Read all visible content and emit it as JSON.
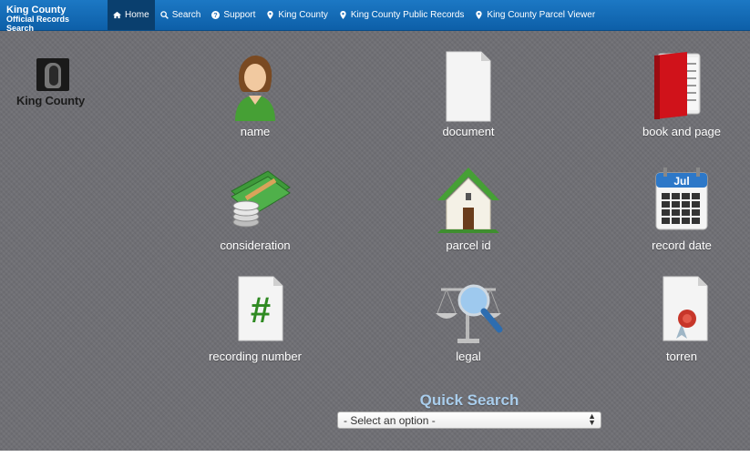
{
  "brand": {
    "line1": "King County",
    "line2": "Official Records Search"
  },
  "nav": [
    {
      "label": "Home",
      "icon": "home-icon",
      "active": true
    },
    {
      "label": "Search",
      "icon": "search-icon"
    },
    {
      "label": "Support",
      "icon": "question-icon"
    },
    {
      "label": "King County",
      "icon": "map-marker-icon"
    },
    {
      "label": "King County Public Records",
      "icon": "map-marker-icon"
    },
    {
      "label": "King County Parcel Viewer",
      "icon": "map-marker-icon"
    }
  ],
  "logo": {
    "text": "King County"
  },
  "tiles": [
    {
      "label": "name",
      "icon": "person-icon"
    },
    {
      "label": "document",
      "icon": "document-icon"
    },
    {
      "label": "book and page",
      "icon": "book-icon"
    },
    {
      "label": "consideration",
      "icon": "money-icon"
    },
    {
      "label": "parcel id",
      "icon": "house-icon"
    },
    {
      "label": "record date",
      "icon": "calendar-icon",
      "calendar_month": "Jul"
    },
    {
      "label": "recording number",
      "icon": "hash-document-icon",
      "symbol": "#"
    },
    {
      "label": "legal",
      "icon": "scales-magnifier-icon"
    },
    {
      "label": "torren",
      "icon": "sealed-document-icon"
    }
  ],
  "quick_search": {
    "title": "Quick Search",
    "selected": "- Select an option -"
  },
  "colors": {
    "nav_bg": "#1768b5",
    "page_bg": "#6f6f74",
    "quick_search_title": "#a9cdec"
  }
}
